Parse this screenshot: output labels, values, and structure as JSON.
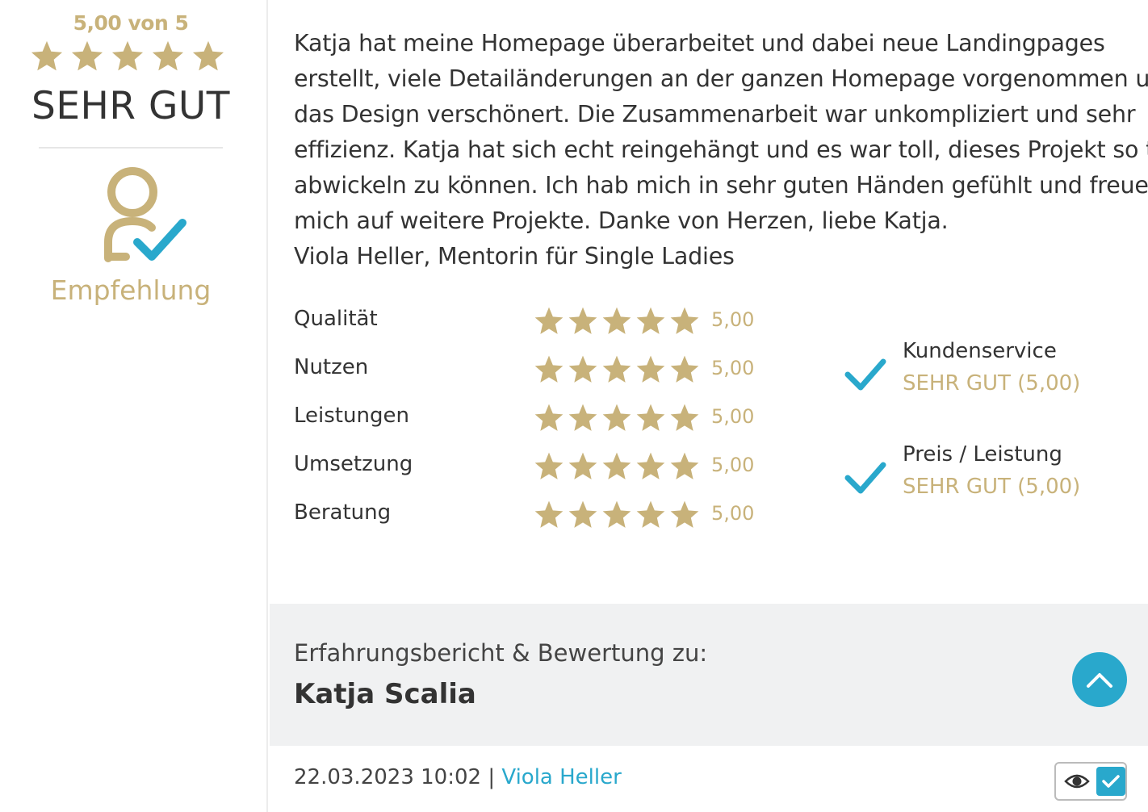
{
  "sidebar": {
    "score_text": "5,00 von 5",
    "star_count": 5,
    "verdict": "SEHR GUT",
    "recommend_label": "Empfehlung",
    "recommend_icon": "user-check-icon"
  },
  "review": {
    "lines": [
      "Katja hat meine Homepage überarbeitet und dabei neue Landingpages",
      "erstellt, viele Detailänderungen an der ganzen Homepage vorgenommen und",
      "das Design verschönert. Die Zusammenarbeit war unkompliziert und sehr",
      "effizienz. Katja hat sich echt reingehängt und es war toll, dieses Projekt so toll",
      "abwickeln zu können. Ich hab mich in sehr guten Händen gefühlt und freue",
      "mich auf weitere Projekte. Danke von Herzen, liebe Katja.",
      "Viola Heller, Mentorin für Single Ladies"
    ]
  },
  "ratings": [
    {
      "label": "Qualität",
      "stars": 5,
      "value": "5,00"
    },
    {
      "label": "Nutzen",
      "stars": 5,
      "value": "5,00"
    },
    {
      "label": "Leistungen",
      "stars": 5,
      "value": "5,00"
    },
    {
      "label": "Umsetzung",
      "stars": 5,
      "value": "5,00"
    },
    {
      "label": "Beratung",
      "stars": 5,
      "value": "5,00"
    }
  ],
  "extras": [
    {
      "title": "Kundenservice",
      "sub": "SEHR GUT (5,00)"
    },
    {
      "title": "Preis / Leistung",
      "sub": "SEHR GUT (5,00)"
    }
  ],
  "band": {
    "label": "Erfahrungsbericht & Bewertung zu:",
    "name": "Katja Scalia",
    "scroll_icon": "chevron-up-icon"
  },
  "meta": {
    "date": "22.03.2023 10:02",
    "separator": " | ",
    "author": "Viola Heller"
  },
  "colors": {
    "gold": "#c8b27a",
    "accent": "#29a8cc",
    "band_bg": "#f0f1f2",
    "text": "#333333"
  }
}
